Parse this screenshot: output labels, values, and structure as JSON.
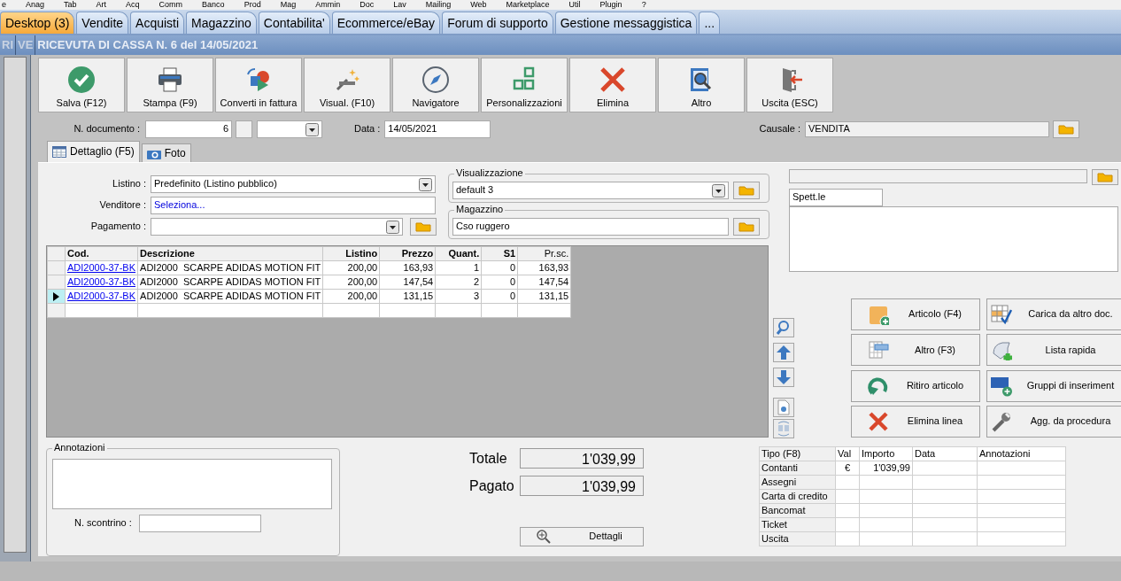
{
  "menu": [
    "e",
    "Anag",
    "Tab",
    "Art",
    "Acq",
    "Comm",
    "Banco",
    "Prod",
    "Mag",
    "Ammin",
    "Doc",
    "Lav",
    "Mailing",
    "Web",
    "Marketplace",
    "Util",
    "Plugin",
    "?"
  ],
  "tabs": [
    {
      "label": "Desktop (3)",
      "selected": true
    },
    {
      "label": "Vendite",
      "selected": false
    },
    {
      "label": "Acquisti",
      "selected": false
    },
    {
      "label": "Magazzino",
      "selected": false
    },
    {
      "label": "Contabilita'",
      "selected": false
    },
    {
      "label": "Ecommerce/eBay",
      "selected": false
    },
    {
      "label": "Forum di supporto",
      "selected": false
    },
    {
      "label": "Gestione messaggistica",
      "selected": false
    },
    {
      "label": "...",
      "selected": false
    }
  ],
  "background_windows": [
    "RI",
    "VE"
  ],
  "window": {
    "title": "RICEVUTA DI CASSA N. 6 del 14/05/2021"
  },
  "toolbar": [
    "Salva (F12)",
    "Stampa (F9)",
    "Converti in fattura",
    "Visual. (F10)",
    "Navigatore",
    "Personalizzazioni",
    "Elimina",
    "Altro",
    "Uscita (ESC)"
  ],
  "header": {
    "doc_label": "N. documento :",
    "doc_number": "6",
    "date_label": "Data :",
    "date": "14/05/2021",
    "causale_label": "Causale :",
    "causale": "VENDITA"
  },
  "detail_tabs": [
    {
      "label": "Dettaglio (F5)",
      "selected": true
    },
    {
      "label": "Foto",
      "selected": false
    }
  ],
  "form": {
    "listino_label": "Listino :",
    "listino": "Predefinito (Listino pubblico)",
    "venditore_label": "Venditore :",
    "venditore": "Seleziona...",
    "pagamento_label": "Pagamento :"
  },
  "visualizzazione": {
    "legend": "Visualizzazione",
    "value": "default 3"
  },
  "magazzino": {
    "legend": "Magazzino",
    "value": "Cso ruggero"
  },
  "customer": {
    "salutation": "Spett.le"
  },
  "lines": {
    "columns": [
      "Cod.",
      "Descrizione",
      "Listino",
      "Prezzo",
      "Quant.",
      "S1",
      "Pr.sc."
    ],
    "rows": [
      {
        "cells": [
          "ADI2000-37-BK",
          "ADI2000  SCARPE ADIDAS MOTION FIT",
          "200,00",
          "163,93",
          "1",
          "0",
          "163,93"
        ],
        "selected": false
      },
      {
        "cells": [
          "ADI2000-37-BK",
          "ADI2000  SCARPE ADIDAS MOTION FIT",
          "200,00",
          "147,54",
          "2",
          "0",
          "147,54"
        ],
        "selected": false
      },
      {
        "cells": [
          "ADI2000-37-BK",
          "ADI2000  SCARPE ADIDAS MOTION FIT",
          "200,00",
          "131,15",
          "3",
          "0",
          "131,15"
        ],
        "selected": true
      }
    ]
  },
  "actions": [
    "Articolo (F4)",
    "Carica da altro doc.",
    "Altro (F3)",
    "Lista rapida",
    "Ritiro articolo",
    "Gruppi di inseriment",
    "Elimina linea",
    "Agg. da procedura"
  ],
  "annotazioni": {
    "legend": "Annotazioni",
    "receipt_label": "N. scontrino :"
  },
  "totals": [
    {
      "label": "Totale",
      "value": "1'039,99"
    },
    {
      "label": "Pagato",
      "value": "1'039,99"
    }
  ],
  "details_button": "Dettagli",
  "payments": {
    "columns": [
      "Tipo (F8)",
      "Val",
      "Importo",
      "Data",
      "Annotazioni"
    ],
    "rows": [
      {
        "type": "Contanti",
        "currency": "€",
        "amount": "1'039,99"
      },
      {
        "type": "Assegni"
      },
      {
        "type": "Carta di credito"
      },
      {
        "type": "Bancomat"
      },
      {
        "type": "Ticket"
      },
      {
        "type": "Uscita"
      }
    ]
  }
}
